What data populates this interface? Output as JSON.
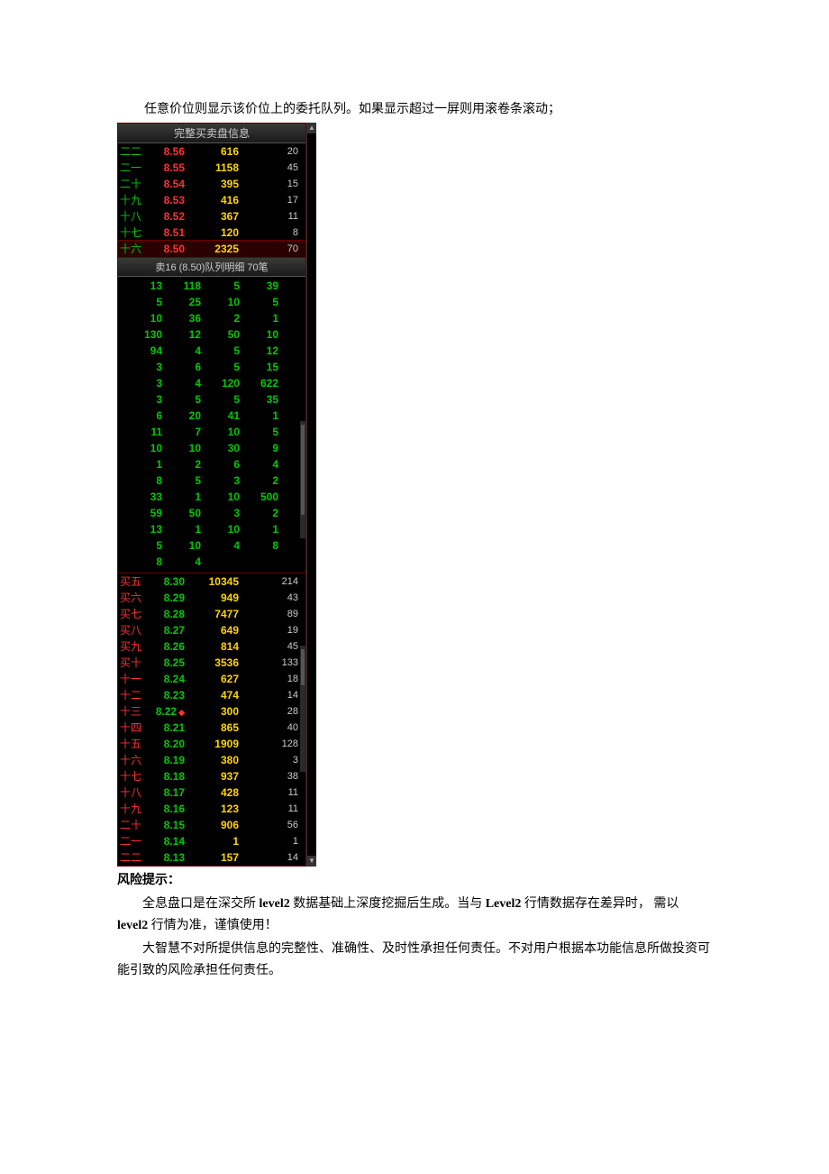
{
  "intro": "任意价位则显示该价位上的委托队列。如果显示超过一屏则用滚卷条滚动；",
  "panel_title": "完整买卖盘信息",
  "queue_header": "卖16 (8.50)队列明细 70笔",
  "sell_rows": [
    {
      "label": "二二",
      "price": "8.56",
      "vol": "616",
      "cnt": "20"
    },
    {
      "label": "二一",
      "price": "8.55",
      "vol": "1158",
      "cnt": "45"
    },
    {
      "label": "二十",
      "price": "8.54",
      "vol": "395",
      "cnt": "15"
    },
    {
      "label": "十九",
      "price": "8.53",
      "vol": "416",
      "cnt": "17"
    },
    {
      "label": "十八",
      "price": "8.52",
      "vol": "367",
      "cnt": "11"
    },
    {
      "label": "十七",
      "price": "8.51",
      "vol": "120",
      "cnt": "8"
    },
    {
      "label": "十六",
      "price": "8.50",
      "vol": "2325",
      "cnt": "70",
      "highlight": true
    }
  ],
  "queue_cells": [
    "13",
    "118",
    "5",
    "39",
    "5",
    "25",
    "10",
    "5",
    "10",
    "36",
    "2",
    "1",
    "130",
    "12",
    "50",
    "10",
    "94",
    "4",
    "5",
    "12",
    "3",
    "6",
    "5",
    "15",
    "3",
    "4",
    "120",
    "622",
    "3",
    "5",
    "5",
    "35",
    "6",
    "20",
    "41",
    "1",
    "11",
    "7",
    "10",
    "5",
    "10",
    "10",
    "30",
    "9",
    "1",
    "2",
    "6",
    "4",
    "8",
    "5",
    "3",
    "2",
    "33",
    "1",
    "10",
    "500",
    "59",
    "50",
    "3",
    "2",
    "13",
    "1",
    "10",
    "1",
    "5",
    "10",
    "4",
    "8",
    "8",
    "4",
    "",
    ""
  ],
  "buy_rows": [
    {
      "label": "买五",
      "price": "8.30",
      "vol": "10345",
      "cnt": "214"
    },
    {
      "label": "买六",
      "price": "8.29",
      "vol": "949",
      "cnt": "43"
    },
    {
      "label": "买七",
      "price": "8.28",
      "vol": "7477",
      "cnt": "89"
    },
    {
      "label": "买八",
      "price": "8.27",
      "vol": "649",
      "cnt": "19"
    },
    {
      "label": "买九",
      "price": "8.26",
      "vol": "814",
      "cnt": "45"
    },
    {
      "label": "买十",
      "price": "8.25",
      "vol": "3536",
      "cnt": "133"
    },
    {
      "label": "十一",
      "price": "8.24",
      "vol": "627",
      "cnt": "18"
    },
    {
      "label": "十二",
      "price": "8.23",
      "vol": "474",
      "cnt": "14"
    },
    {
      "label": "十三",
      "price": "8.22",
      "vol": "300",
      "cnt": "28",
      "diamond": true
    },
    {
      "label": "十四",
      "price": "8.21",
      "vol": "865",
      "cnt": "40"
    },
    {
      "label": "十五",
      "price": "8.20",
      "vol": "1909",
      "cnt": "128"
    },
    {
      "label": "十六",
      "price": "8.19",
      "vol": "380",
      "cnt": "3"
    },
    {
      "label": "十七",
      "price": "8.18",
      "vol": "937",
      "cnt": "38"
    },
    {
      "label": "十八",
      "price": "8.17",
      "vol": "428",
      "cnt": "11"
    },
    {
      "label": "十九",
      "price": "8.16",
      "vol": "123",
      "cnt": "11"
    },
    {
      "label": "二十",
      "price": "8.15",
      "vol": "906",
      "cnt": "56"
    },
    {
      "label": "二一",
      "price": "8.14",
      "vol": "1",
      "cnt": "1"
    },
    {
      "label": "二二",
      "price": "8.13",
      "vol": "157",
      "cnt": "14"
    }
  ],
  "risk_title": "风险提示：",
  "risk_p1_a": "全息盘口是在深交所 ",
  "risk_p1_b": "level2",
  "risk_p1_c": " 数据基础上深度挖掘后生成。当与 ",
  "risk_p1_d": "Level2",
  "risk_p1_e": " 行情数据存在差异时， 需以 ",
  "risk_p1_f": "level2",
  "risk_p1_g": " 行情为准，谨慎使用！",
  "risk_p2": "大智慧不对所提供信息的完整性、准确性、及时性承担任何责任。不对用户根据本功能信息所做投资可能引致的风险承担任何责任。"
}
